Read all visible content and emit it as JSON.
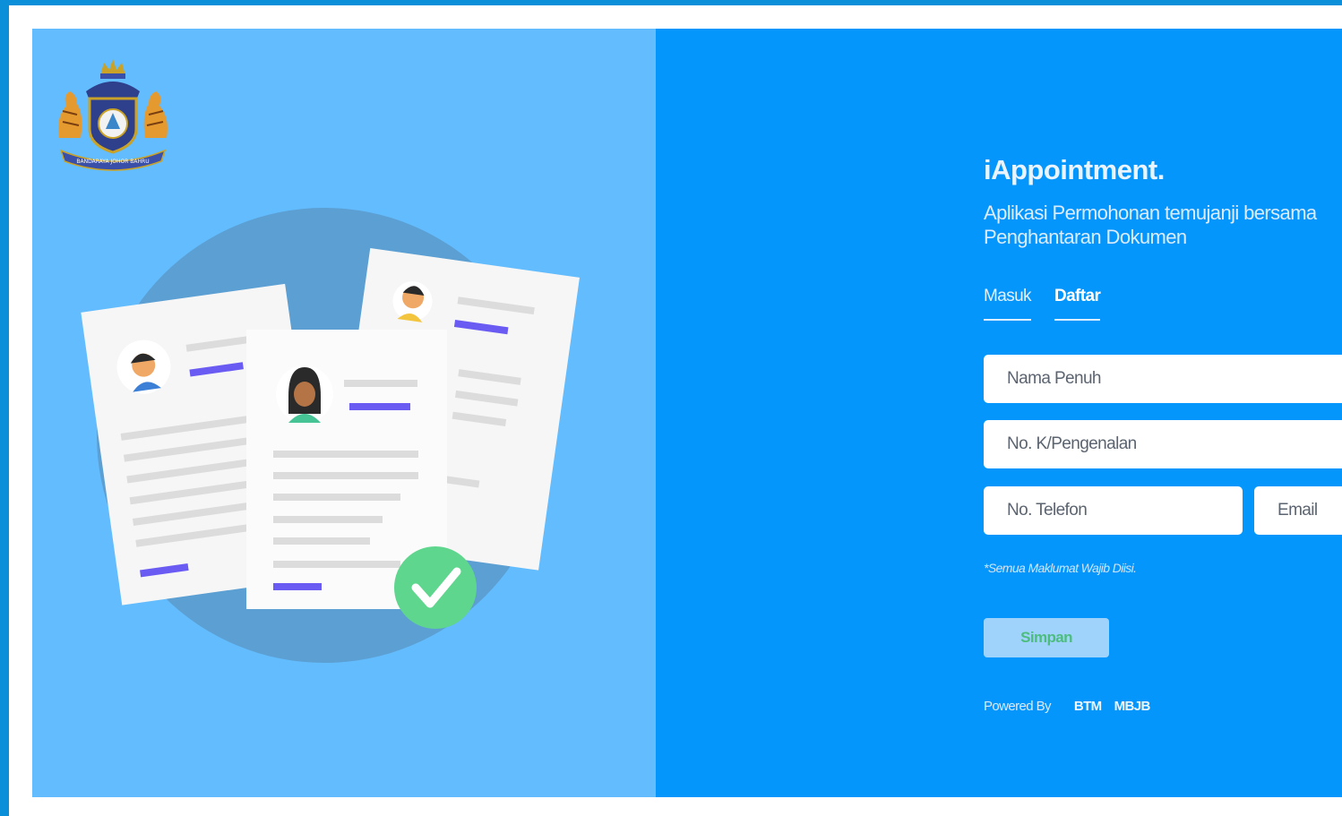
{
  "app": {
    "title": "iAppointment.",
    "subtitle_line1": "Aplikasi Permohonan temujanji bersama",
    "subtitle_line2": "Penghantaran Dokumen"
  },
  "tabs": [
    {
      "label": "Masuk",
      "active": false
    },
    {
      "label": "Daftar",
      "active": true
    }
  ],
  "form": {
    "name_placeholder": "Nama Penuh",
    "ic_placeholder": "No. K/Pengenalan",
    "phone_placeholder": "No. Telefon",
    "email_placeholder": "Email",
    "note": "*Semua Maklumat Wajib Diisi.",
    "save_label": "Simpan"
  },
  "footer": {
    "powered_label": "Powered By",
    "brands": [
      "BTM",
      "MBJB"
    ]
  },
  "logo": {
    "emblem_text": "BANDARAYA JOHOR BAHRU"
  },
  "colors": {
    "frame": "#0a8fd8",
    "illustration_bg": "#63bcfd",
    "form_bg": "#0596fc",
    "circle": "#5b9fd3",
    "accent_bar": "#6a5cf2",
    "check_badge": "#5fd68d",
    "button_bg": "#9fd3fb",
    "button_text": "#4dbd7e"
  }
}
